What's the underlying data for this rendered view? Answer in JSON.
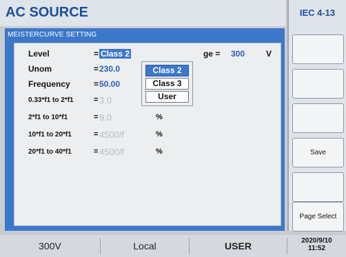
{
  "header": {
    "title": "AC SOURCE",
    "standard": "IEC 4-13"
  },
  "panel": {
    "title": "MEISTERCURVE SETTING",
    "level": {
      "label": "Level",
      "eq": "=",
      "value": "Class 2"
    },
    "voltage": {
      "partial_label": "ge =",
      "value": "300",
      "unit": "V"
    },
    "unom": {
      "label": "Unom",
      "eq": "=",
      "value": "230.0"
    },
    "frequency": {
      "label": "Frequency",
      "eq": "=",
      "value": "50.00"
    },
    "rows": [
      {
        "label": "0.33*f1 to 2*f1",
        "eq": "=",
        "value": "3.0",
        "unit": "%"
      },
      {
        "label": "2*f1 to 10*f1",
        "eq": "=",
        "value": "9.0",
        "unit": "%"
      },
      {
        "label": "10*f1 to 20*f1",
        "eq": "=",
        "value": "4500/f",
        "unit": "%"
      },
      {
        "label": "20*f1 to 40*f1",
        "eq": "=",
        "value": "4500/f",
        "unit": "%"
      }
    ]
  },
  "dropdown": {
    "options": [
      "Class 2",
      "Class 3",
      "User"
    ],
    "selected": "Class 2"
  },
  "softkeys": [
    "",
    "",
    "",
    "Save",
    "",
    "Page Select"
  ],
  "status": {
    "voltage": "300V",
    "mode": "Local",
    "user": "USER",
    "date": "2020/9/10",
    "time": "11:52"
  }
}
